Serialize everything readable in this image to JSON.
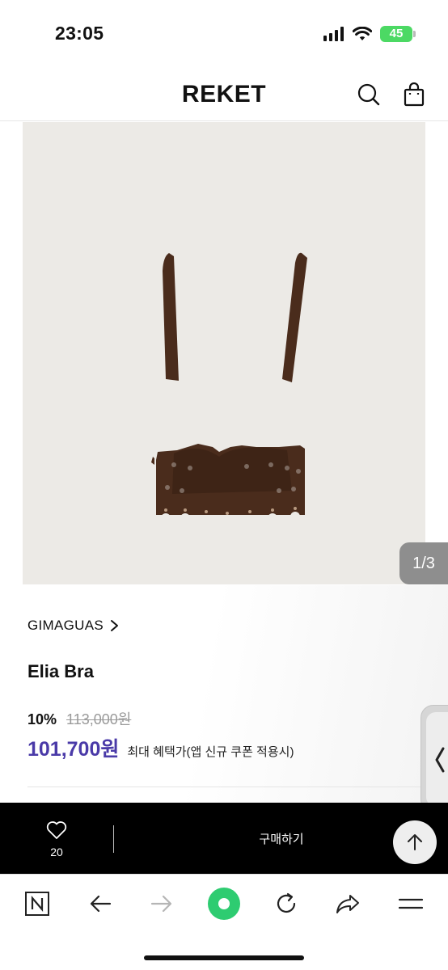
{
  "status": {
    "time": "23:05",
    "battery": "45"
  },
  "header": {
    "logo": "REKET"
  },
  "gallery": {
    "page_indicator": "1/3"
  },
  "product": {
    "brand": "GIMAGUAS",
    "brand_arrow": ">",
    "name": "Elia Bra",
    "discount": "10%",
    "original_price": "113,000원",
    "final_price": "101,700원",
    "benefit_note": "최대 혜택가(앱 신규 쿠폰 적용시)"
  },
  "buy_bar": {
    "like_count": "20",
    "buy_label": "구매하기"
  },
  "icons": {
    "search": "search-icon",
    "bag": "shopping-bag-icon",
    "heart": "heart-icon",
    "top": "arrow-up-icon",
    "naver": "naver-n-icon",
    "back": "back-arrow-icon",
    "forward": "forward-arrow-icon",
    "home": "green-dot-icon",
    "reload": "reload-icon",
    "share": "share-icon",
    "menu": "menu-icon",
    "side_tab": "chevron-left-icon"
  },
  "colors": {
    "final_price": "#4a3aa8",
    "buy_bar": "#000000",
    "battery": "#4cd964",
    "home_button": "#2ecc71",
    "product": "#4a2c1c"
  }
}
